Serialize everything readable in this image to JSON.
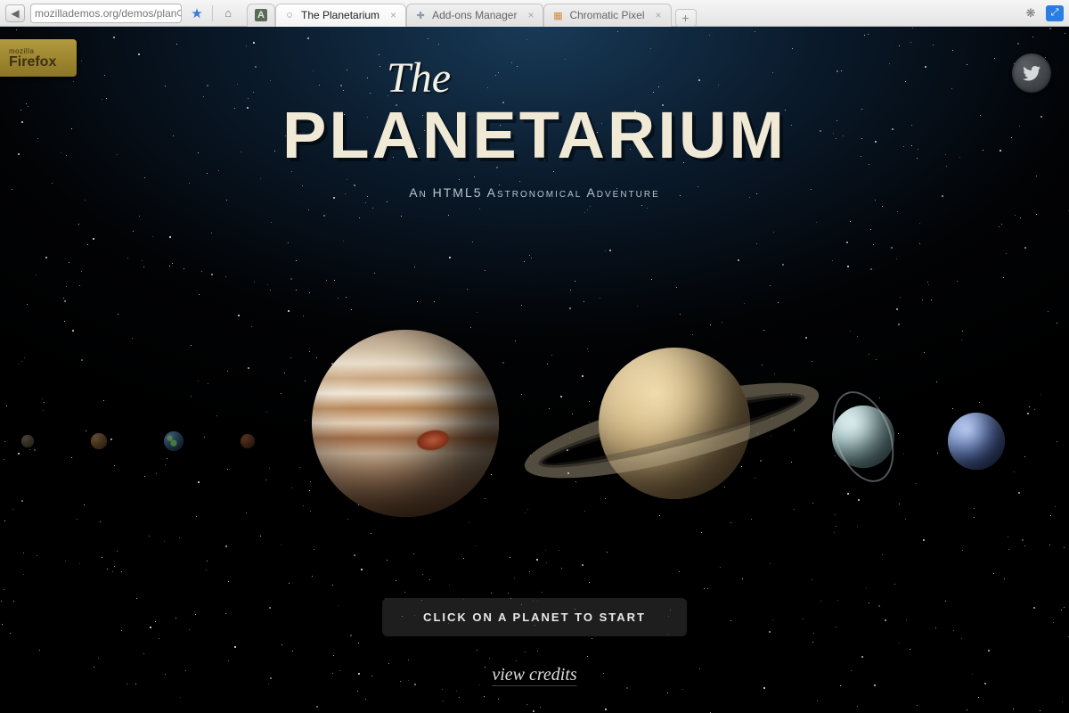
{
  "browser": {
    "url_display": "mozillademos.org/demos/plan",
    "tabs": [
      {
        "label": "",
        "icon": "A",
        "pinned": true
      },
      {
        "label": "The Planetarium",
        "icon": "◌",
        "active": true
      },
      {
        "label": "Add-ons Manager",
        "icon": "✚"
      },
      {
        "label": "Chromatic Pixel",
        "icon": "▦"
      }
    ]
  },
  "badge": {
    "line1": "mozilla",
    "line2": "Firefox"
  },
  "title": {
    "the": "The",
    "main": "PLANETARIUM",
    "subtitle": "An HTML5 Astronomical Adventure"
  },
  "planets": {
    "mercury": "Mercury",
    "venus": "Venus",
    "earth": "Earth",
    "mars": "Mars",
    "jupiter": "Jupiter",
    "saturn": "Saturn",
    "uranus": "Uranus",
    "neptune": "Neptune"
  },
  "instruction": "CLICK ON A PLANET TO START",
  "credits_label": "view credits"
}
